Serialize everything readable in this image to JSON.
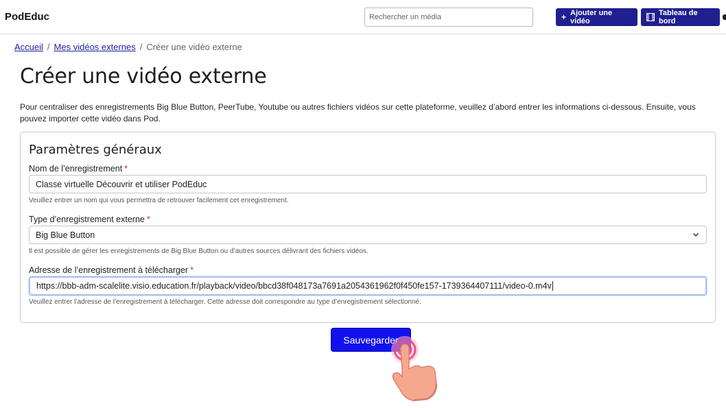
{
  "header": {
    "brand": "PodEduc",
    "search_placeholder": "Rechercher un média",
    "add_video_label": "Ajouter une vidéo",
    "add_video_icon": "plus-icon",
    "dashboard_label": "Tableau de bord",
    "dashboard_icon": "film-icon"
  },
  "breadcrumb": {
    "home": "Accueil",
    "separator": "/",
    "external_videos": "Mes vidéos externes",
    "current": "Créer une vidéo externe"
  },
  "page": {
    "title": "Créer une vidéo externe",
    "intro": "Pour centraliser des enregistrements Big Blue Button, PeerTube, Youtube ou autres fichiers vidéos sur cette plateforme, veuillez d’abord entrer les informations ci-dessous. Ensuite, vous pouvez importer cette vidéo dans Pod."
  },
  "form": {
    "section_title": "Paramètres généraux",
    "required_mark": "*",
    "name": {
      "label": "Nom de l’enregistrement",
      "value": "Classe virtuelle Découvrir et utiliser PodEduc",
      "help": "Veuillez entrer un nom qui vous permettra de retrouver facilement cet enregistrement."
    },
    "type": {
      "label": "Type d’enregistrement externe",
      "selected": "Big Blue Button",
      "help": "Il est possible de gérer les enregistrements de Big Blue Button ou d’autres sources délivrant des fichiers vidéos."
    },
    "url": {
      "label": "Adresse de l’enregistrement à télécharger",
      "value": "https://bbb-adm-scalelite.visio.education.fr/playback/video/bbcd38f048173a7691a2054361962f0f450fe157-1739364407111/video-0.m4v",
      "help": "Veuillez entrer l’adresse de l’enregistrement à télécharger. Cette adresse doit correspondre au type d’enregistrement sélectionné."
    },
    "save_label": "Sauvegarder"
  },
  "colors": {
    "primary_dark": "#1f1f8f",
    "save_button": "#1111ee",
    "link": "#1f1f9f",
    "required": "#d9262c",
    "cursor_hand": "#f3a08c"
  }
}
